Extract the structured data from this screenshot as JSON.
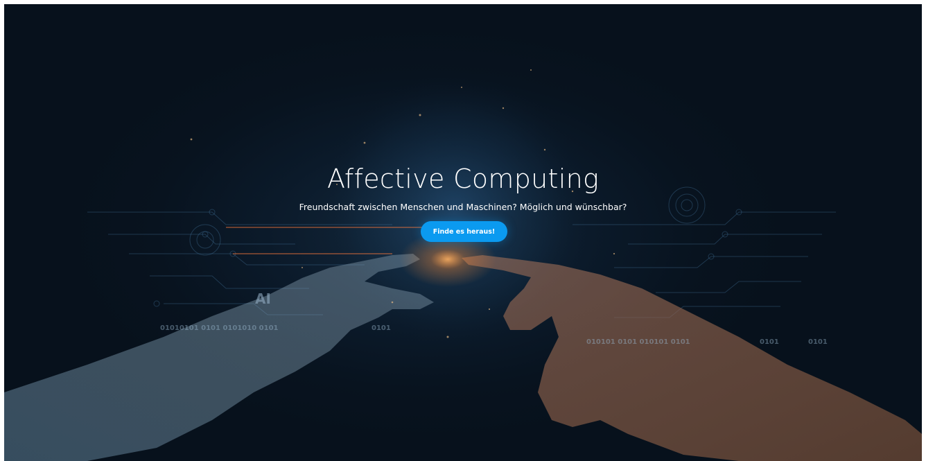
{
  "hero": {
    "title": "Affective Computing",
    "subtitle": "Freundschaft zwischen Menschen und Maschinen? Möglich und wünschbar?",
    "cta_label": "Finde es heraus!"
  },
  "background": {
    "ai_label": "AI",
    "binary_labels": [
      "01010101 0101 0101010 0101",
      "0101",
      "010101 0101 010101 0101",
      "0101",
      "0101"
    ]
  },
  "colors": {
    "background": "#08131f",
    "button": "#0b9af0",
    "circuit": "#4a7fa8",
    "glow": "#ff9a3c"
  }
}
